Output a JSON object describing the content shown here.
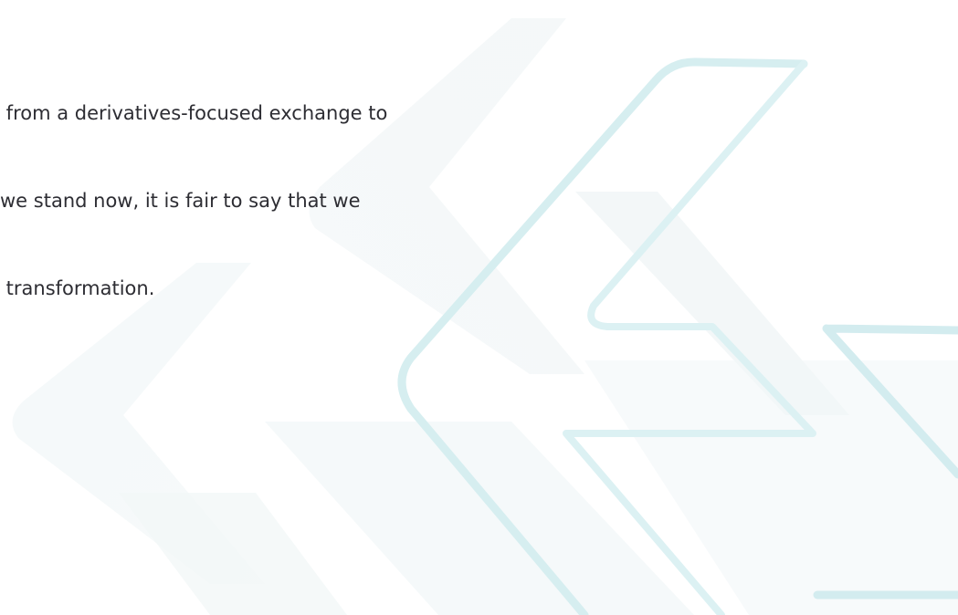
{
  "document": {
    "paragraph_lines": [
      " from a derivatives-focused exchange to",
      "we stand now, it is fair to say that we",
      " transformation."
    ]
  },
  "colors": {
    "text": "#2d2d33",
    "accent_outline": "#d6eef0",
    "shape_fill": "#f3f7f8"
  },
  "icons": {
    "background": "chevron-pattern-icon"
  }
}
